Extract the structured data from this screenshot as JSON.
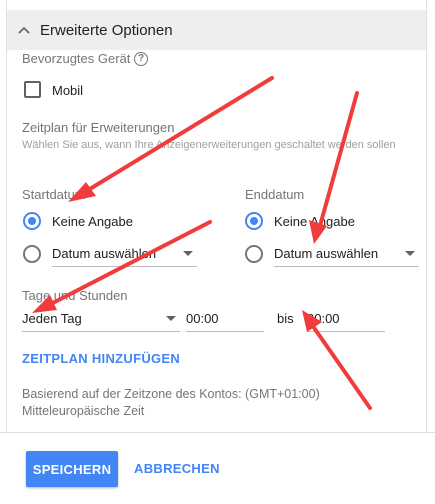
{
  "panel": {
    "title": "Erweiterte Optionen",
    "preferred_device_label": "Bevorzugtes Gerät",
    "help_glyph": "?",
    "mobile_label": "Mobil",
    "schedule_title": "Zeitplan für Erweiterungen",
    "schedule_hint": "Wählen Sie aus, wann Ihre Anzeigenerweiterungen geschaltet werden sollen"
  },
  "start": {
    "label": "Startdatum",
    "option_none": "Keine Angabe",
    "option_pick": "Datum auswählen"
  },
  "end": {
    "label": "Enddatum",
    "option_none": "Keine Angabe",
    "option_pick": "Datum auswählen"
  },
  "days": {
    "label": "Tage und Stunden",
    "day_value": "Jeden Tag",
    "from_time": "00:00",
    "to_label": "bis",
    "to_time": "00:00"
  },
  "add_schedule_label": "ZEITPLAN HINZUFÜGEN",
  "timezone_note": "Basierend auf der Zeitzone des Kontos: (GMT+01:00) Mitteleuropäische Zeit",
  "footer": {
    "save_label": "SPEICHERN",
    "cancel_label": "ABBRECHEN"
  },
  "colors": {
    "accent": "#4285f4",
    "annotation_arrow": "#f03c3c"
  },
  "icons": [
    "chevron-up-icon",
    "help-icon",
    "dropdown-caret-icon"
  ]
}
